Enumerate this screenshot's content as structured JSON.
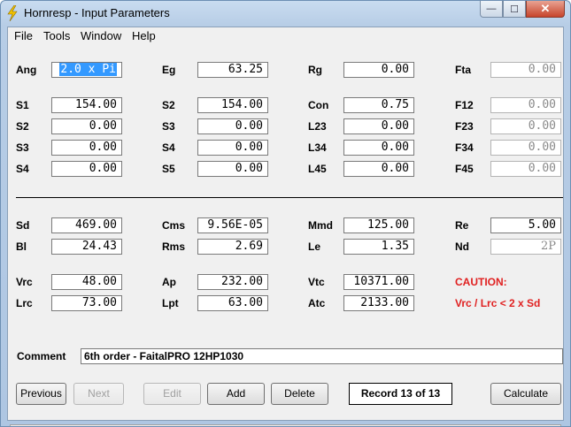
{
  "window": {
    "title": "Hornresp - Input Parameters",
    "icon": "lightning-bolt-icon"
  },
  "caption_buttons": {
    "minimize": "—",
    "maximize": "☐",
    "close": "✕"
  },
  "menu": [
    "File",
    "Tools",
    "Window",
    "Help"
  ],
  "params": {
    "ang": {
      "label": "Ang",
      "value": "2.0 x Pi"
    },
    "eg": {
      "label": "Eg",
      "value": "63.25"
    },
    "rg": {
      "label": "Rg",
      "value": "0.00"
    },
    "fta": {
      "label": "Fta",
      "value": "0.00"
    },
    "s1": {
      "label": "S1",
      "value": "154.00"
    },
    "s2a": {
      "label": "S2",
      "value": "154.00"
    },
    "con": {
      "label": "Con",
      "value": "0.75"
    },
    "f12": {
      "label": "F12",
      "value": "0.00"
    },
    "s2b": {
      "label": "S2",
      "value": "0.00"
    },
    "s3a": {
      "label": "S3",
      "value": "0.00"
    },
    "l23": {
      "label": "L23",
      "value": "0.00"
    },
    "f23": {
      "label": "F23",
      "value": "0.00"
    },
    "s3b": {
      "label": "S3",
      "value": "0.00"
    },
    "s4a": {
      "label": "S4",
      "value": "0.00"
    },
    "l34": {
      "label": "L34",
      "value": "0.00"
    },
    "f34": {
      "label": "F34",
      "value": "0.00"
    },
    "s4b": {
      "label": "S4",
      "value": "0.00"
    },
    "s5": {
      "label": "S5",
      "value": "0.00"
    },
    "l45": {
      "label": "L45",
      "value": "0.00"
    },
    "f45": {
      "label": "F45",
      "value": "0.00"
    },
    "sd": {
      "label": "Sd",
      "value": "469.00"
    },
    "cms": {
      "label": "Cms",
      "value": "9.56E-05"
    },
    "mmd": {
      "label": "Mmd",
      "value": "125.00"
    },
    "re": {
      "label": "Re",
      "value": "5.00"
    },
    "bl": {
      "label": "Bl",
      "value": "24.43"
    },
    "rms": {
      "label": "Rms",
      "value": "2.69"
    },
    "le": {
      "label": "Le",
      "value": "1.35"
    },
    "nd": {
      "label": "Nd",
      "value": "2P"
    },
    "vrc": {
      "label": "Vrc",
      "value": "48.00"
    },
    "ap": {
      "label": "Ap",
      "value": "232.00"
    },
    "vtc": {
      "label": "Vtc",
      "value": "10371.00"
    },
    "lrc": {
      "label": "Lrc",
      "value": "73.00"
    },
    "lpt": {
      "label": "Lpt",
      "value": "63.00"
    },
    "atc": {
      "label": "Atc",
      "value": "2133.00"
    }
  },
  "caution": {
    "title": "CAUTION:",
    "message": "Vrc / Lrc < 2 x Sd",
    "color": "#e02020"
  },
  "comment": {
    "label": "Comment",
    "value": "6th order - FaitalPRO 12HP1030"
  },
  "buttons": {
    "previous": "Previous",
    "next": "Next",
    "edit": "Edit",
    "add": "Add",
    "delete": "Delete",
    "calculate": "Calculate"
  },
  "record": "Record 13 of 13",
  "colors": {
    "selection": "#3399ff",
    "caution": "#e02020",
    "client_bg": "#f0f0f0"
  }
}
